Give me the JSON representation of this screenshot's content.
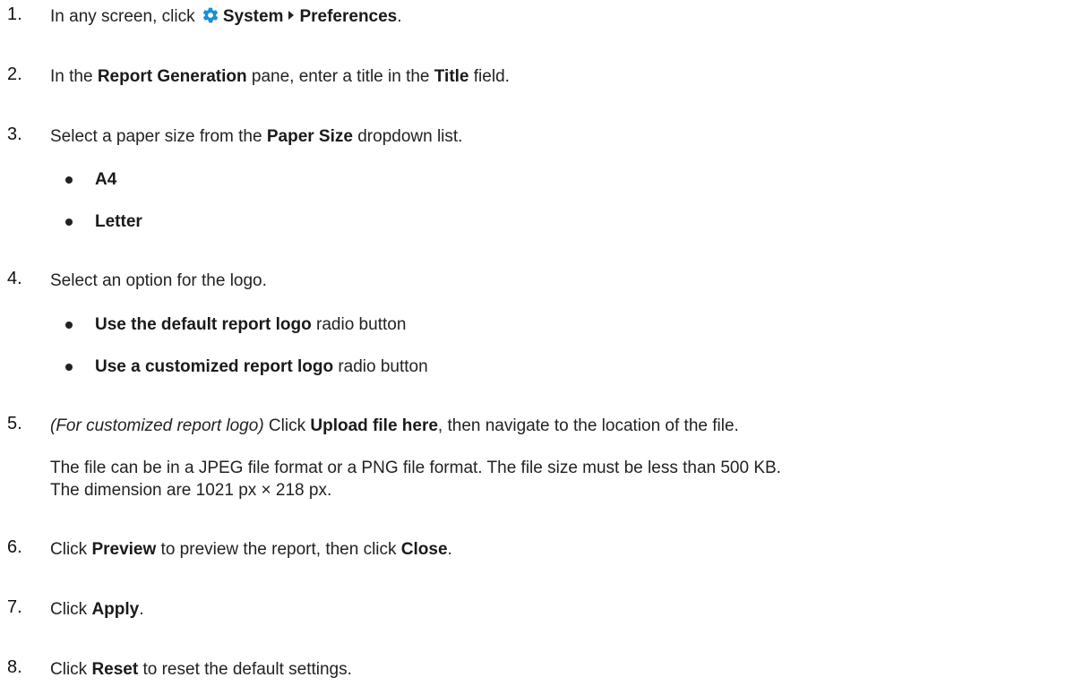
{
  "steps": [
    {
      "num": "1.",
      "a": "In any screen, click ",
      "icon": "gear-icon",
      "b1": "System",
      "b2": "Preferences",
      "end": "."
    },
    {
      "num": "2.",
      "a": "In the ",
      "b1": "Report Generation",
      "m": " pane, enter a title in the ",
      "b2": "Title",
      "end": " field."
    },
    {
      "num": "3.",
      "a": "Select a paper size from the ",
      "b1": "Paper Size",
      "end": " dropdown list."
    },
    {
      "num": "4.",
      "a": "Select an option for the logo."
    },
    {
      "num": "5.",
      "italic": "(For customized report logo)",
      "a": " Click ",
      "b1": "Upload file here",
      "end": ", then navigate to the location of the file."
    },
    {
      "num": "6.",
      "a": "Click ",
      "b1": "Preview",
      "m": " to preview the report, then click ",
      "b2": "Close",
      "end": "."
    },
    {
      "num": "7.",
      "a": "Click ",
      "b1": "Apply",
      "end": "."
    },
    {
      "num": "8.",
      "a": "Click ",
      "b1": "Reset",
      "end": " to reset the default settings."
    }
  ],
  "paper_sizes": [
    "A4",
    "Letter"
  ],
  "logo_options": [
    {
      "bold": "Use the default report logo",
      "rest": " radio button"
    },
    {
      "bold": "Use a customized report logo",
      "rest": " radio button"
    }
  ],
  "step5_note_line1": "The file can be in a JPEG file format or a PNG file format. The file size must be less than 500 KB.",
  "step5_note_line2": "The dimension are 1021 px × 218 px.",
  "colors": {
    "gear_icon": "#1a8fd6",
    "text": "#222222"
  }
}
